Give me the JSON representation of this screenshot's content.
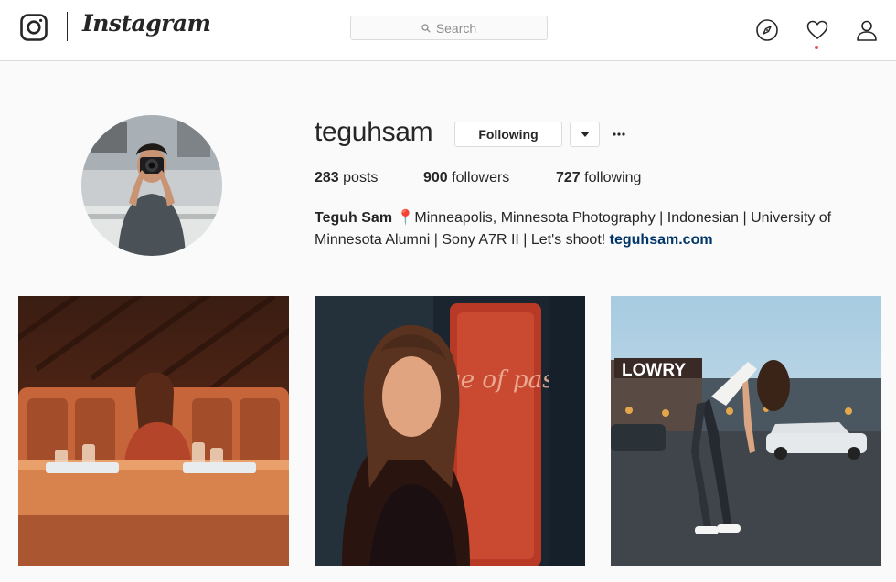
{
  "app": {
    "name": "Instagram"
  },
  "search": {
    "placeholder": "Search"
  },
  "nav": {
    "icons": [
      "explore-icon",
      "heart-icon",
      "profile-icon"
    ]
  },
  "colors": {
    "notification_dot": "#ed4956",
    "link": "#003569",
    "border": "#dbdbdb"
  },
  "profile": {
    "username": "teguhsam",
    "follow_label": "Following",
    "stats": {
      "posts_count": "283",
      "posts_label": "posts",
      "followers_count": "900",
      "followers_label": "followers",
      "following_count": "727",
      "following_label": "following"
    },
    "bio": {
      "name": "Teguh Sam",
      "pin": "📍",
      "text_1": "Minneapolis, Minnesota Photography | Indonesian | University of",
      "text_2": "Minnesota Alumni | Sony A7R II | Let's shoot! ",
      "link": "teguhsam.com"
    }
  },
  "posts": [
    {
      "sign": ""
    },
    {
      "sign": "change of passion"
    },
    {
      "sign": "LOWRY"
    }
  ]
}
